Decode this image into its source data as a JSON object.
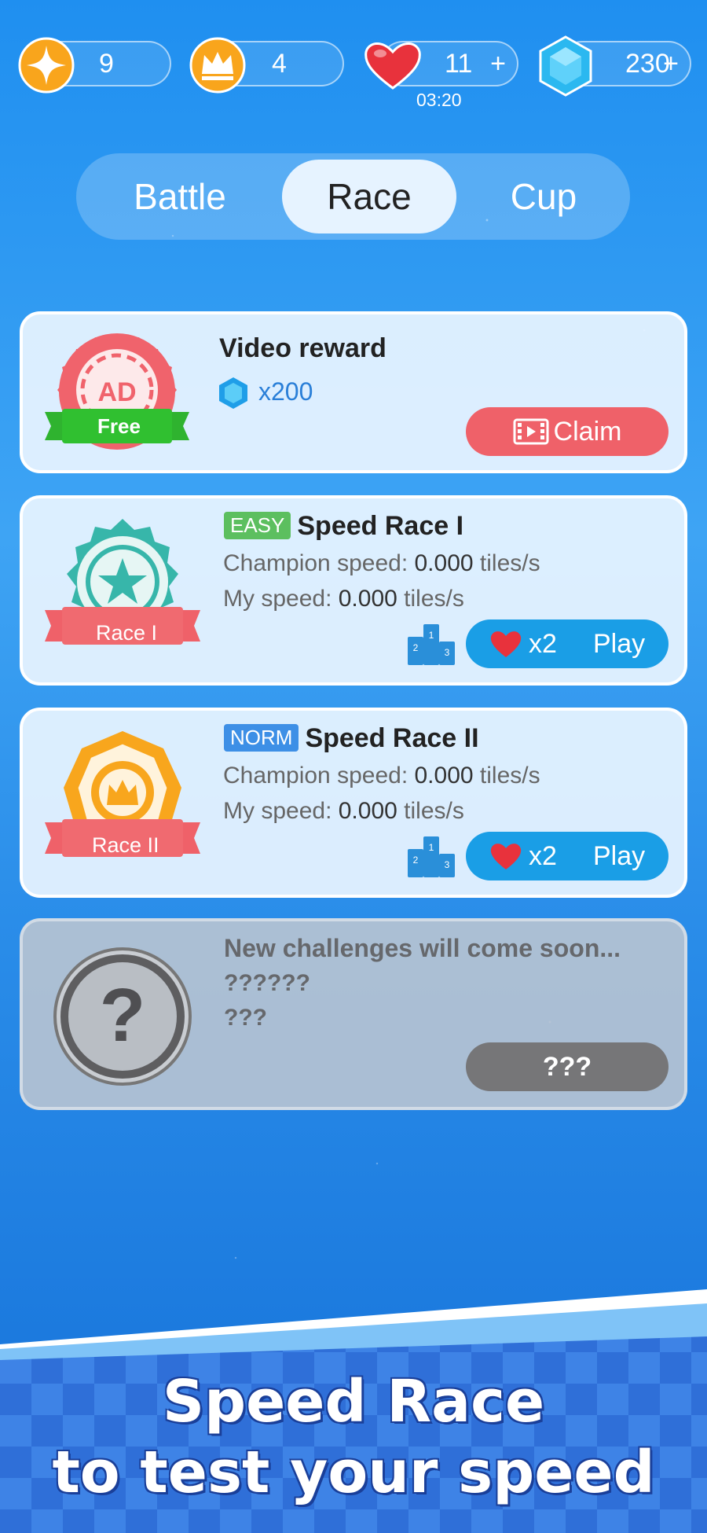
{
  "stats": {
    "stars": {
      "value": "9",
      "icon": "star-icon"
    },
    "crowns": {
      "value": "4",
      "icon": "crown-icon"
    },
    "lives": {
      "value": "11",
      "plus": "+",
      "timer": "03:20",
      "icon": "heart-icon"
    },
    "gems": {
      "value": "230",
      "plus": "+",
      "icon": "gem-icon"
    }
  },
  "tabs": [
    {
      "label": "Battle",
      "active": false
    },
    {
      "label": "Race",
      "active": true
    },
    {
      "label": "Cup",
      "active": false
    }
  ],
  "video_reward": {
    "badge_text": "AD",
    "badge_ribbon": "Free",
    "title": "Video reward",
    "reward": "x200",
    "button": "Claim"
  },
  "races": [
    {
      "tag": "EASY",
      "tag_color": "#5cbf5f",
      "title": "Speed Race I",
      "badge_ribbon": "Race I",
      "champion_label": "Champion speed:",
      "champion_value": "0.000",
      "my_label": "My speed:",
      "my_value": "0.000",
      "unit": "tiles/s",
      "cost": "x2",
      "button": "Play"
    },
    {
      "tag": "NORM",
      "tag_color": "#3d8fe6",
      "title": "Speed Race II",
      "badge_ribbon": "Race II",
      "champion_label": "Champion speed:",
      "champion_value": "0.000",
      "my_label": "My speed:",
      "my_value": "0.000",
      "unit": "tiles/s",
      "cost": "x2",
      "button": "Play"
    }
  ],
  "coming_soon": {
    "title": "New challenges will come soon...",
    "line1": "??????",
    "line2": "???",
    "button": "???",
    "icon_text": "?"
  },
  "banner": {
    "line1": "Speed Race",
    "line2": "to test your speed"
  },
  "colors": {
    "background": "#2a8de9",
    "claim": "#ef6169",
    "play": "#1a9ee6",
    "heart": "#e8323c"
  }
}
